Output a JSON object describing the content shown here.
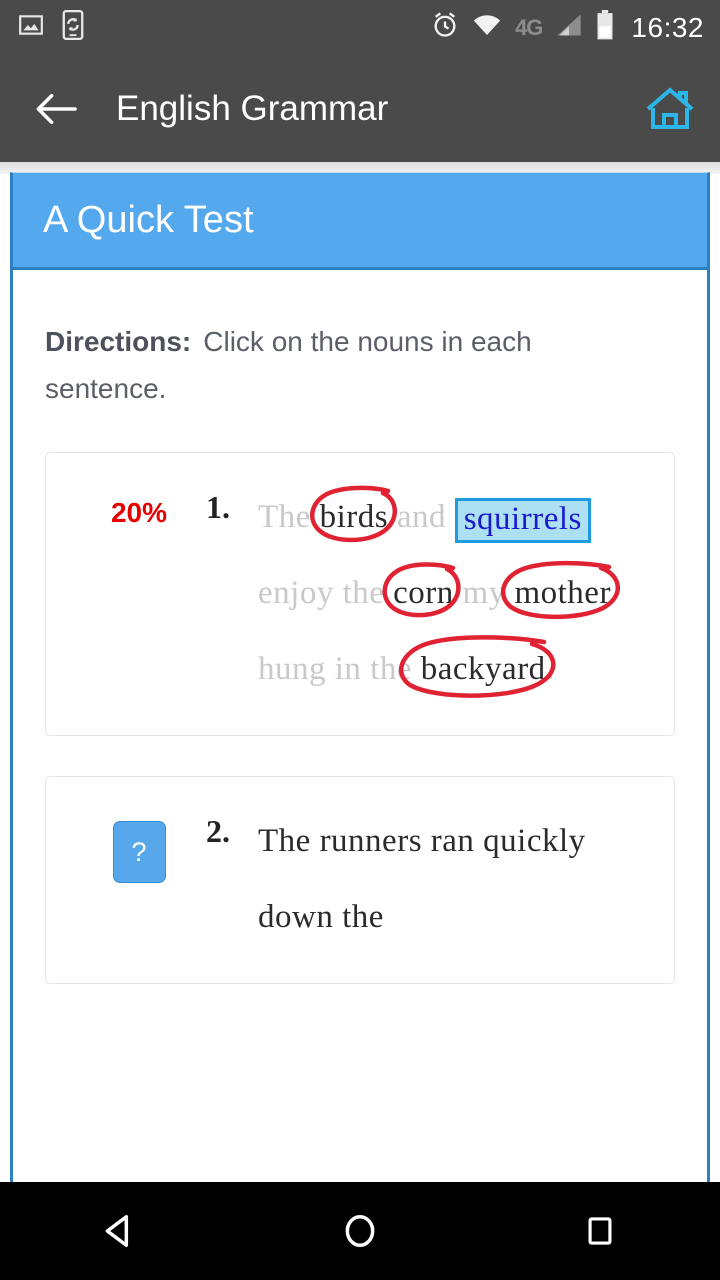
{
  "statusbar": {
    "time": "16:32",
    "network_label": "4G",
    "icons": [
      "image-icon",
      "phone-sync-icon",
      "alarm-icon",
      "wifi-icon",
      "signal-icon",
      "battery-icon"
    ]
  },
  "appbar": {
    "title": "English Grammar",
    "back_label": "Back",
    "home_label": "Home",
    "bg_color": "#4a4a4a",
    "home_icon_color": "#2cb6e8"
  },
  "panel": {
    "header_title": "A Quick Test",
    "header_bg": "#54a8ed",
    "border_color": "#2e7fc1"
  },
  "directions": {
    "label": "Directions:",
    "text": "Click on the nouns in each sentence."
  },
  "questions": [
    {
      "number": "1.",
      "score": "20%",
      "score_color": "#e60000",
      "tokens": [
        {
          "text": "The",
          "state": "dim"
        },
        {
          "text": "birds",
          "state": "circled"
        },
        {
          "text": "and",
          "state": "dim"
        },
        {
          "text": "squirrels",
          "state": "selected"
        },
        {
          "text": "enjoy",
          "state": "dim"
        },
        {
          "text": "the",
          "state": "dim"
        },
        {
          "text": "corn",
          "state": "circled"
        },
        {
          "text": "my",
          "state": "dim"
        },
        {
          "text": "mother",
          "state": "circled"
        },
        {
          "text": "hung",
          "state": "dim"
        },
        {
          "text": "in",
          "state": "dim"
        },
        {
          "text": "the",
          "state": "dim"
        },
        {
          "text": "backyard",
          "state": "circled"
        },
        {
          "text": ".",
          "state": "dim"
        }
      ]
    },
    {
      "number": "2.",
      "hint_label": "?",
      "hint_bg": "#56a8ea",
      "tokens": [
        {
          "text": "The",
          "state": "plain"
        },
        {
          "text": "runners",
          "state": "plain"
        },
        {
          "text": "ran",
          "state": "plain"
        },
        {
          "text": "quickly",
          "state": "plain"
        },
        {
          "text": "down",
          "state": "plain"
        },
        {
          "text": "the",
          "state": "plain"
        }
      ]
    }
  ],
  "navbar": {
    "back_label": "Back",
    "home_label": "Home",
    "recents_label": "Recents"
  }
}
